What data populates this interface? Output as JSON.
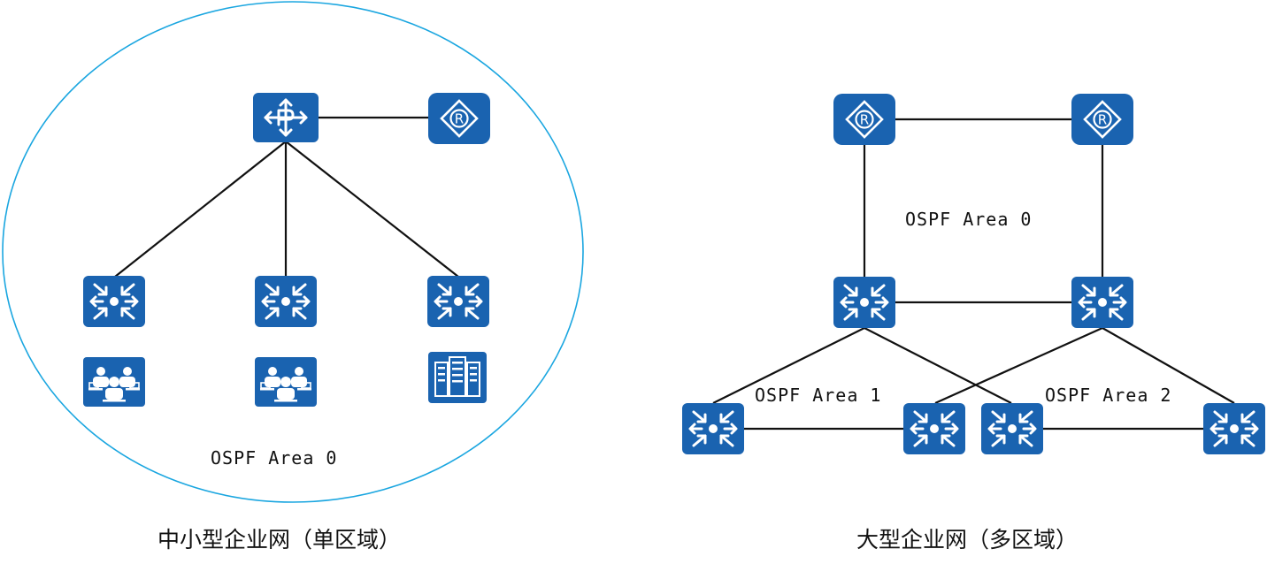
{
  "colors": {
    "device_blue": "#1a63b0",
    "boundary": "#1aa6e0",
    "link": "#111111",
    "text": "#111111"
  },
  "left": {
    "area_label": "OSPF Area 0",
    "caption": "中小型企业网（单区域）",
    "devices": {
      "core": {
        "icon": "core-router-icon"
      },
      "router": {
        "icon": "router-icon"
      },
      "switch_1": {
        "icon": "switch-icon"
      },
      "switch_2": {
        "icon": "switch-icon"
      },
      "switch_3": {
        "icon": "switch-icon"
      },
      "users_1": {
        "icon": "users-icon"
      },
      "users_2": {
        "icon": "users-icon"
      },
      "server": {
        "icon": "server-icon"
      }
    }
  },
  "right": {
    "area0_label": "OSPF Area 0",
    "area1_label": "OSPF Area 1",
    "area2_label": "OSPF Area 2",
    "caption": "大型企业网（多区域）",
    "devices": {
      "router_left": {
        "icon": "router-icon"
      },
      "router_right": {
        "icon": "router-icon"
      },
      "core_switch_left": {
        "icon": "switch-icon"
      },
      "core_switch_right": {
        "icon": "switch-icon"
      },
      "access_switch_1": {
        "icon": "switch-icon"
      },
      "access_switch_2": {
        "icon": "switch-icon"
      },
      "access_switch_3": {
        "icon": "switch-icon"
      },
      "access_switch_4": {
        "icon": "switch-icon"
      }
    }
  }
}
